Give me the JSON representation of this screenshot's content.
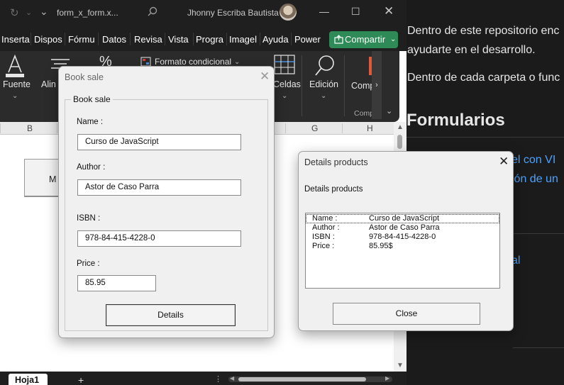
{
  "titlebar": {
    "filename": "form_x_form.x...",
    "username": "Jhonny Escriba Bautista"
  },
  "ribbon_tabs": [
    "Inserta",
    "Dispos",
    "Fórmu",
    "Datos",
    "Revisa",
    "Vista",
    "Progra",
    "Imagel",
    "Ayuda",
    "Power"
  ],
  "share_label": "Compartir",
  "ribbon": {
    "fuente": "Fuente",
    "alineacion": "Alin",
    "formato_condicional": "Formato condicional",
    "celdas": "Celdas",
    "edicion": "Edición",
    "comp": "Comp",
    "comp_caption": "Comp"
  },
  "columns": [
    "B",
    "G",
    "H"
  ],
  "sheet_shape_label": "M",
  "sheet_tab": "Hoja1",
  "docpanel": {
    "line1": "Dentro de este repositorio enc",
    "line2": "ayudarte en el desarrollo.",
    "line3": "Dentro de cada carpeta o func",
    "heading": "Formularios",
    "link1": "sel con VI",
    "link2": "ción de un",
    "link3": "cal"
  },
  "book_sale": {
    "title": "Book sale",
    "frame_title": "Book sale",
    "name_label": "Name :",
    "name_value": "Curso de JavaScript",
    "author_label": "Author :",
    "author_value": "Astor de Caso Parra",
    "isbn_label": "ISBN :",
    "isbn_value": "978-84-415-4228-0",
    "price_label": "Price :",
    "price_value": "85.95",
    "details_button": "Details"
  },
  "details_products": {
    "title": "Details products",
    "subtitle": "Details products",
    "items": [
      {
        "key": "Name :",
        "value": "Curso de JavaScript"
      },
      {
        "key": "Author :",
        "value": "Astor de Caso Parra"
      },
      {
        "key": "ISBN :",
        "value": "978-84-415-4228-0"
      },
      {
        "key": "Price :",
        "value": "85.95$"
      }
    ],
    "close_button": "Close"
  },
  "colors": {
    "titlebar_bg": "#1f1f1f",
    "ribbon_bg": "#2b2b2b",
    "share_green": "#2e8b57",
    "link_blue": "#4aa3ff",
    "dialog_bg": "#f0f0f0"
  }
}
